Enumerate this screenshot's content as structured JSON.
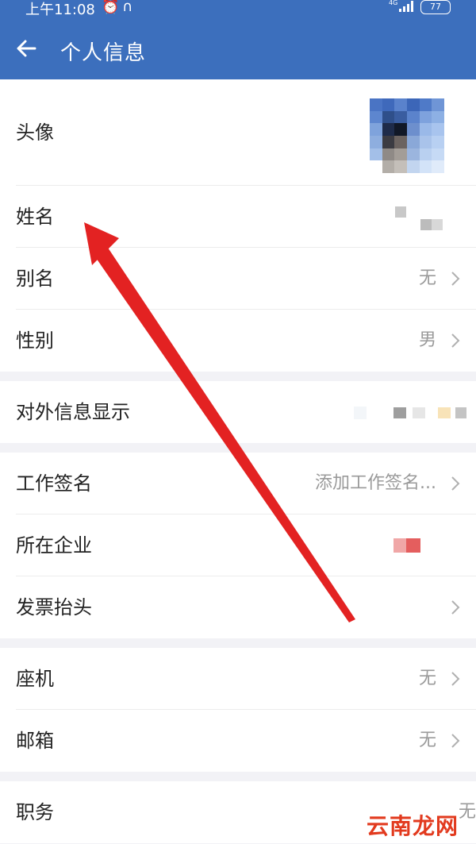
{
  "status": {
    "time": "上午11:08",
    "network": "4G",
    "battery": "77"
  },
  "header": {
    "title": "个人信息"
  },
  "rows": {
    "avatar": {
      "label": "头像"
    },
    "name": {
      "label": "姓名"
    },
    "alias": {
      "label": "别名",
      "value": "无"
    },
    "gender": {
      "label": "性别",
      "value": "男"
    },
    "external": {
      "label": "对外信息显示"
    },
    "signature": {
      "label": "工作签名",
      "value": "添加工作签名..."
    },
    "company": {
      "label": "所在企业"
    },
    "invoice": {
      "label": "发票抬头"
    },
    "landline": {
      "label": "座机",
      "value": "无"
    },
    "email": {
      "label": "邮箱",
      "value": "无"
    },
    "position": {
      "label": "职务",
      "value": "无"
    }
  },
  "watermark": {
    "text": "云南龙网"
  },
  "colors": {
    "header": "#3c6fbd",
    "arrow": "#e32222"
  }
}
